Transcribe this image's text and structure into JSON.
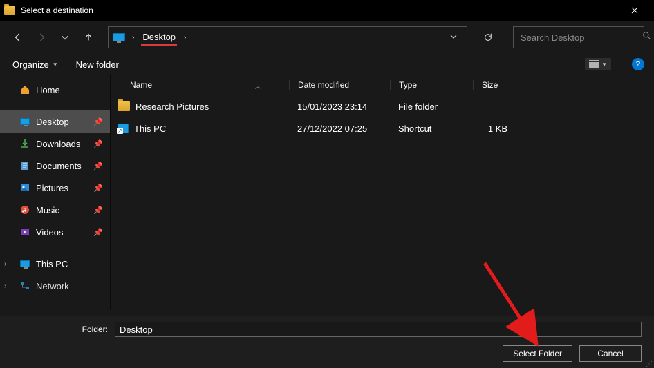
{
  "title": "Select a destination",
  "breadcrumb": {
    "current": "Desktop"
  },
  "search": {
    "placeholder": "Search Desktop"
  },
  "toolbar": {
    "organize": "Organize",
    "newfolder": "New folder"
  },
  "columns": {
    "name": "Name",
    "date": "Date modified",
    "type": "Type",
    "size": "Size"
  },
  "sidebar": {
    "home": "Home",
    "desktop": "Desktop",
    "downloads": "Downloads",
    "documents": "Documents",
    "pictures": "Pictures",
    "music": "Music",
    "videos": "Videos",
    "thispc": "This PC",
    "network": "Network"
  },
  "files": [
    {
      "name": "Research Pictures",
      "date": "15/01/2023 23:14",
      "type": "File folder",
      "size": ""
    },
    {
      "name": "This PC",
      "date": "27/12/2022 07:25",
      "type": "Shortcut",
      "size": "1 KB"
    }
  ],
  "footer": {
    "folder_label": "Folder:",
    "folder_value": "Desktop",
    "select": "Select Folder",
    "cancel": "Cancel"
  }
}
